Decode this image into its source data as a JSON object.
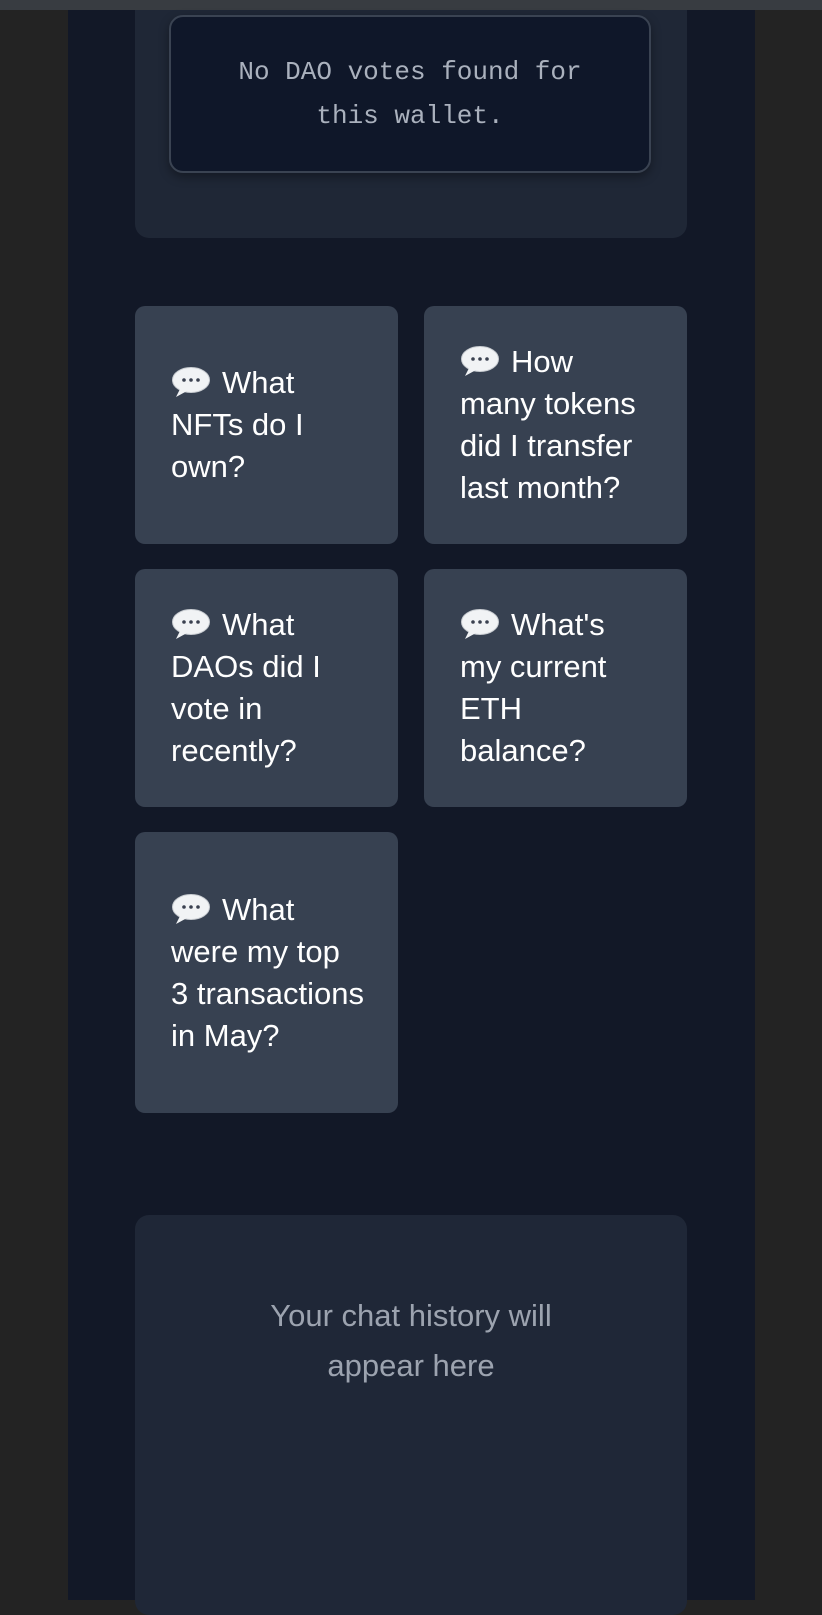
{
  "dao_votes": {
    "empty_message_line1": "No DAO votes found for",
    "empty_message_line2": "this wallet."
  },
  "suggestions": {
    "icon": "speech-bubble-icon",
    "items": [
      {
        "label": "What NFTs do I own?"
      },
      {
        "label": "How many tokens did I transfer last month?"
      },
      {
        "label": "What DAOs did I vote in recently?"
      },
      {
        "label": "What's my current ETH balance?"
      },
      {
        "label": "What were my top 3 transactions in May?"
      }
    ]
  },
  "chat_history": {
    "placeholder_line1": "Your chat history will",
    "placeholder_line2": "appear here"
  },
  "colors": {
    "page_background": "#121827",
    "card_background": "#1f2736",
    "suggestion_background": "#374151",
    "muted_text": "#9ca3af"
  }
}
